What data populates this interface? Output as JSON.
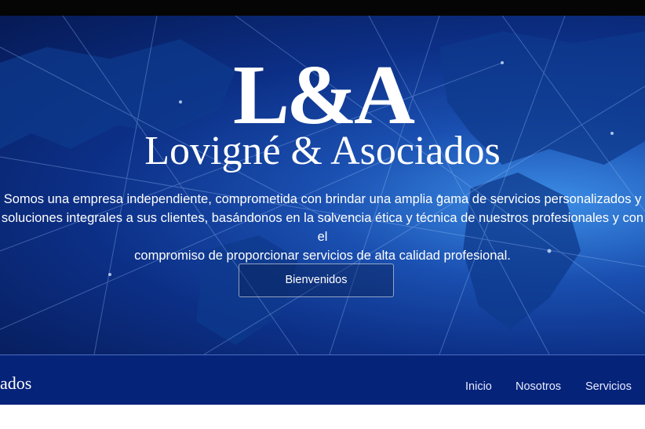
{
  "hero": {
    "logo_mark": "L&A",
    "firm_name": "Lovigné & Asociados",
    "tagline_line1": "Somos una empresa independiente, comprometida con brindar una amplia gama de servicios personalizados y",
    "tagline_line2": "soluciones integrales a sus clientes, basándonos en la solvencia ética y técnica de nuestros profesionales y con el",
    "tagline_line3": "compromiso de proporcionar servicios de alta calidad profesional.",
    "cta_label": "Bienvenidos"
  },
  "navbar": {
    "brand_fragment": "ados",
    "links": [
      {
        "label": "Inicio"
      },
      {
        "label": "Nosotros"
      },
      {
        "label": "Servicios"
      }
    ]
  },
  "colors": {
    "top_bar": "#050505",
    "hero_dark": "#061a55",
    "hero_light": "#3c8ee6",
    "navbar": "#06237a",
    "text": "#ffffff"
  }
}
